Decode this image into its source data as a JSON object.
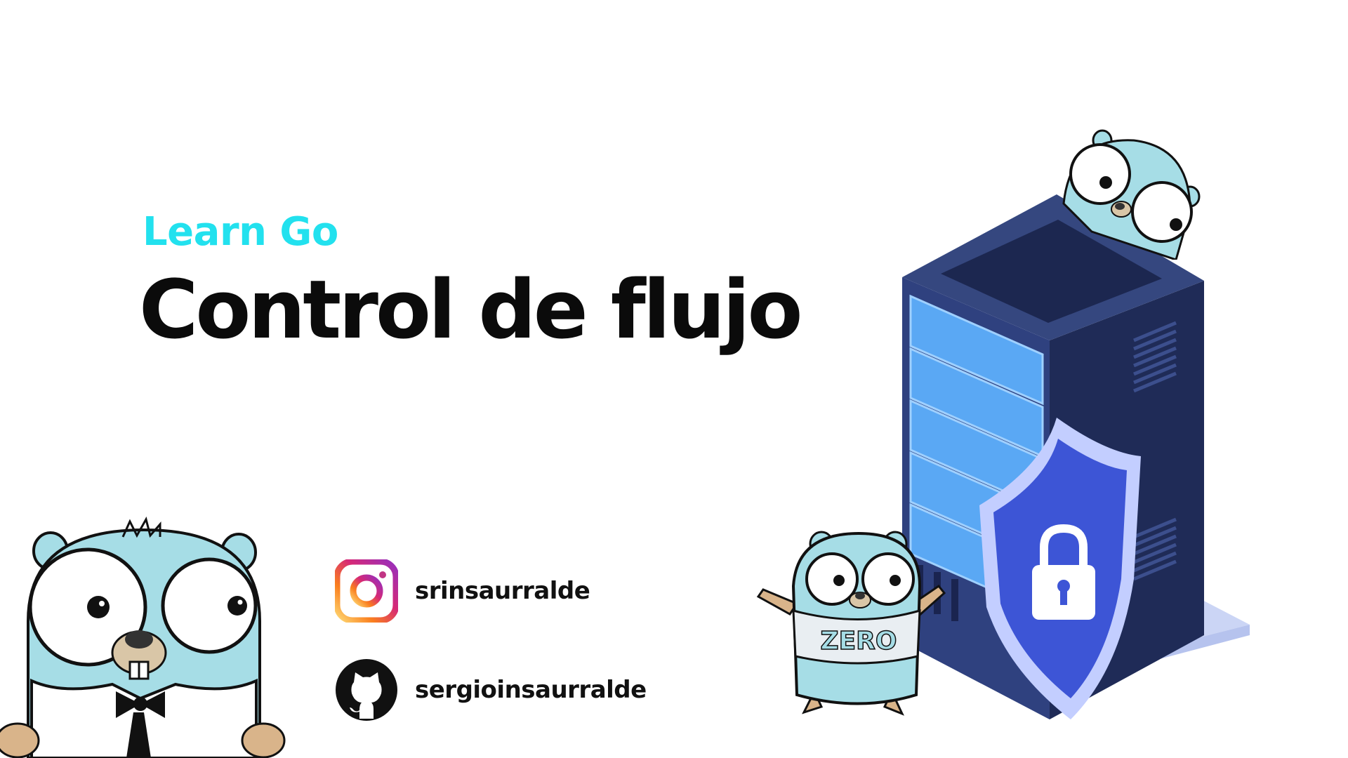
{
  "header": {
    "kicker": "Learn Go",
    "title": "Control de flujo"
  },
  "socials": [
    {
      "icon": "instagram-icon",
      "handle": "srinsaurralde"
    },
    {
      "icon": "github-icon",
      "handle": "sergioinsaurralde"
    }
  ],
  "illustrations": {
    "server": "server-rack-with-shield-lock",
    "mascot_shirt": "ZERO"
  },
  "colors": {
    "accent": "#22e1ee",
    "title": "#0b0b0b",
    "gopher": "#a6dde6",
    "rack": "#2a3a75",
    "drive": "#5aa8f4",
    "shield": "#3d55d6"
  }
}
